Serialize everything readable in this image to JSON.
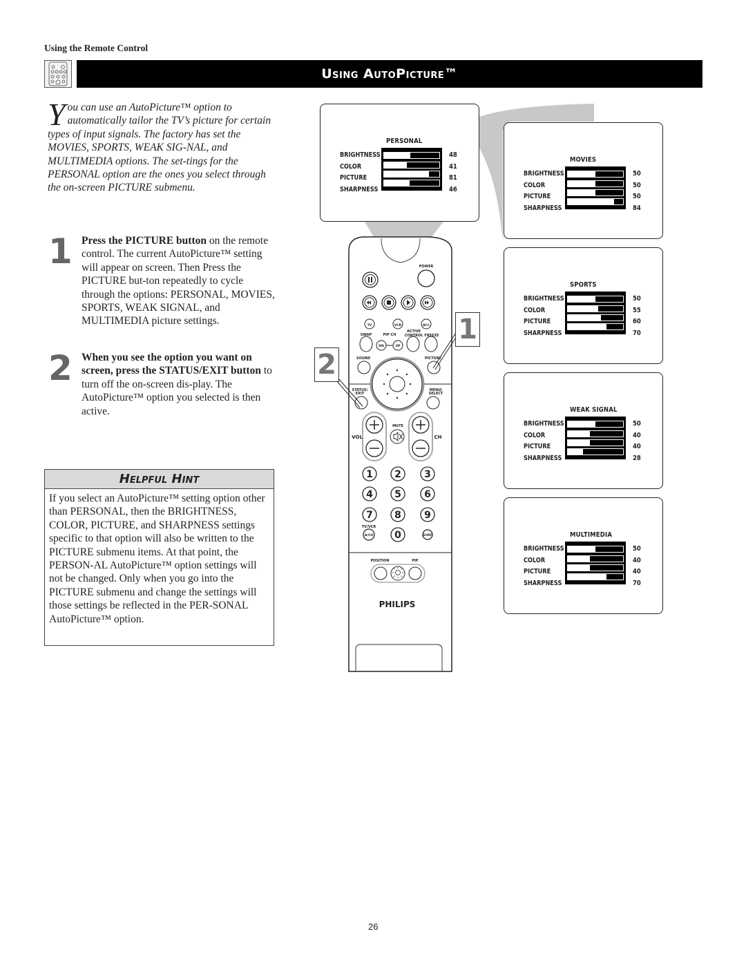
{
  "header": {
    "section_label": "Using the Remote Control",
    "title": "Using AutoPicture™"
  },
  "intro": {
    "dropcap": "Y",
    "text": "ou can use an AutoPicture™ option to automatically tailor the TV’s picture for certain types of input signals. The factory has set the MOVIES, SPORTS, WEAK SIG-NAL, and MULTIMEDIA options. The set-tings for the PERSONAL option are the ones you select through the on-screen PICTURE submenu."
  },
  "steps": [
    {
      "number": "1",
      "bold": "Press the PICTURE button",
      "text": " on the remote control. The current AutoPicture™  setting will appear on screen. Then Press the PICTURE but-ton repeatedly to cycle through the options: PERSONAL, MOVIES, SPORTS, WEAK SIGNAL, and MULTIMEDIA picture settings."
    },
    {
      "number": "2",
      "bold": "When you see the option you want on screen, press the STATUS/EXIT button",
      "text": " to turn off the on-screen dis-play. The AutoPicture™ option you selected is then active."
    }
  ],
  "hint": {
    "title": "Helpful Hint",
    "text": "If you select an AutoPicture™ setting option other than PERSONAL, then the BRIGHTNESS, COLOR, PICTURE, and SHARPNESS settings specific to that option will also be written to the PICTURE submenu items. At that point, the PERSON-AL AutoPicture™ option settings will not be changed. Only when you go into the PICTURE submenu and change the settings will those settings be reflected in the PER-SONAL AutoPicture™ option."
  },
  "osd_labels": [
    "BRIGHTNESS",
    "COLOR",
    "PICTURE",
    "SHARPNESS"
  ],
  "osd_screens": [
    {
      "name": "PERSONAL",
      "values": [
        48,
        41,
        81,
        46
      ]
    },
    {
      "name": "MOVIES",
      "values": [
        50,
        50,
        50,
        84
      ]
    },
    {
      "name": "SPORTS",
      "values": [
        50,
        55,
        60,
        70
      ]
    },
    {
      "name": "WEAK  SIGNAL",
      "values": [
        50,
        40,
        40,
        28
      ]
    },
    {
      "name": "MULTIMEDIA",
      "values": [
        50,
        40,
        40,
        70
      ]
    }
  ],
  "callouts": {
    "one": "1",
    "two": "2"
  },
  "remote": {
    "brand": "PHILIPS",
    "labels": {
      "power": "POWER",
      "tv": "TV",
      "vcr": "VCR",
      "acc": "ACC",
      "swap": "SWAP",
      "pipch": "PIP CH",
      "active": "ACTIVE",
      "control": "CONTROL",
      "freeze": "FREEZE",
      "dn": "DN",
      "up": "UP",
      "sound": "SOUND",
      "picture": "PICTURE",
      "status": "STATUS/",
      "exit": "EXIT",
      "menu": "MENU/",
      "select": "SELECT",
      "mute": "MUTE",
      "vol": "VOL",
      "ch": "CH",
      "tvvcr": "TV/VCR",
      "ach": "A/CH",
      "surf": "SURF",
      "position": "POSITION",
      "pip": "PIP"
    },
    "digits": [
      "1",
      "2",
      "3",
      "4",
      "5",
      "6",
      "7",
      "8",
      "9",
      "0"
    ]
  },
  "page_number": "26"
}
